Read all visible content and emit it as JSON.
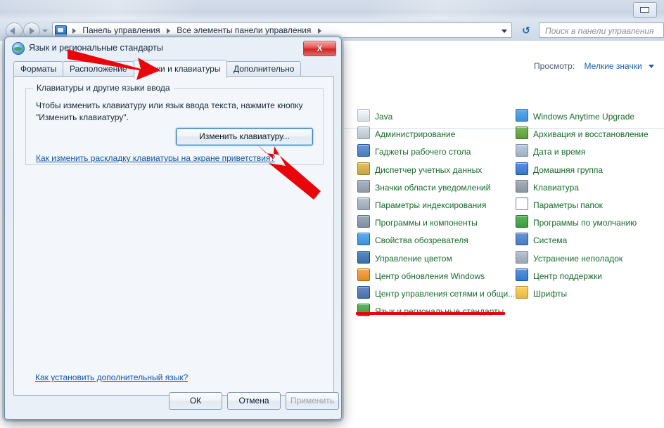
{
  "window": {
    "restore_button_label": "Restore",
    "nav": {
      "back_label": "Назад",
      "forward_label": "Вперед",
      "recent_label": "Последние страницы"
    },
    "address": {
      "crumb1": "Панель управления",
      "crumb2": "Все элементы панели управления",
      "dropdown_label": "Предыдущие папки",
      "refresh_label": "Обновить"
    },
    "search": {
      "placeholder": "Поиск в панели управления",
      "value": ""
    }
  },
  "view": {
    "label": "Просмотр:",
    "value": "Мелкие значки"
  },
  "control_panel": {
    "column_a": [
      {
        "label": "Java",
        "icon": "java-icon",
        "color": "#d8dde2"
      },
      {
        "label": "Администрирование",
        "icon": "admin-tools-icon",
        "color": "#b9c3cc"
      },
      {
        "label": "Гаджеты рабочего стола",
        "icon": "desktop-gadgets-icon",
        "color": "#4a7bbd"
      },
      {
        "label": "Диспетчер учетных данных",
        "icon": "credential-manager-icon",
        "color": "#c8a34a"
      },
      {
        "label": "Значки области уведомлений",
        "icon": "notification-area-icon",
        "color": "#8d99a6"
      },
      {
        "label": "Параметры индексирования",
        "icon": "indexing-options-icon",
        "color": "#9aa7b5"
      },
      {
        "label": "Программы и компоненты",
        "icon": "programs-features-icon",
        "color": "#7e8fa2"
      },
      {
        "label": "Свойства обозревателя",
        "icon": "internet-options-icon",
        "color": "#3f8fd4"
      },
      {
        "label": "Управление цветом",
        "icon": "color-management-icon",
        "color": "#3b6ea8"
      },
      {
        "label": "Центр обновления Windows",
        "icon": "windows-update-icon",
        "color": "#e08a2e"
      },
      {
        "label": "Центр управления сетями и общи...",
        "icon": "network-sharing-center-icon",
        "color": "#4c6fa8"
      },
      {
        "label": "Язык и региональные стандарты",
        "icon": "region-language-icon",
        "color": "#3f9a44"
      }
    ],
    "column_b": [
      {
        "label": "Windows Anytime Upgrade",
        "icon": "anytime-upgrade-icon",
        "color": "#3f8fd4"
      },
      {
        "label": "Архивация и восстановление",
        "icon": "backup-restore-icon",
        "color": "#5d9b3e"
      },
      {
        "label": "Дата и время",
        "icon": "date-time-icon",
        "color": "#9fb0c2"
      },
      {
        "label": "Домашняя группа",
        "icon": "homegroup-icon",
        "color": "#3a77c4"
      },
      {
        "label": "Клавиатура",
        "icon": "keyboard-icon",
        "color": "#8b949e"
      },
      {
        "label": "Параметры папок",
        "icon": "folder-options-icon",
        "color": "#e2b košu"
      },
      {
        "label": "Программы по умолчанию",
        "icon": "default-programs-icon",
        "color": "#3f9a44"
      },
      {
        "label": "Система",
        "icon": "system-icon",
        "color": "#4a7bbd"
      },
      {
        "label": "Устранение неполадок",
        "icon": "troubleshooting-icon",
        "color": "#9aa7b5"
      },
      {
        "label": "Центр поддержки",
        "icon": "action-center-icon",
        "color": "#3a77c4"
      },
      {
        "label": "Шрифты",
        "icon": "fonts-icon",
        "color": "#e0b84a"
      }
    ]
  },
  "dialog": {
    "title": "Язык и региональные стандарты",
    "close_label": "X",
    "tabs": [
      {
        "label": "Форматы",
        "active": false
      },
      {
        "label": "Расположение",
        "active": false
      },
      {
        "label": "Языки и клавиатуры",
        "active": true
      },
      {
        "label": "Дополнительно",
        "active": false
      }
    ],
    "groupbox": {
      "legend": "Клавиатуры и другие языки ввода",
      "text": "Чтобы изменить клавиатуру или язык ввода текста, нажмите кнопку \"Изменить клавиатуру\".",
      "button": "Изменить клавиатуру...",
      "link": "Как изменить раскладку клавиатуры на экране приветствия?"
    },
    "install_link": "Как установить дополнительный язык?",
    "footer": {
      "ok": "ОК",
      "cancel": "Отмена",
      "apply": "Применить"
    }
  },
  "annotations": {
    "accent_color": "#e8060a",
    "arrow_to_tab": "arrow-pointing-to-languages-tab",
    "arrow_to_button": "arrow-pointing-to-change-keyboard-button",
    "underline_region_item": "underline-under-region-language-item"
  }
}
